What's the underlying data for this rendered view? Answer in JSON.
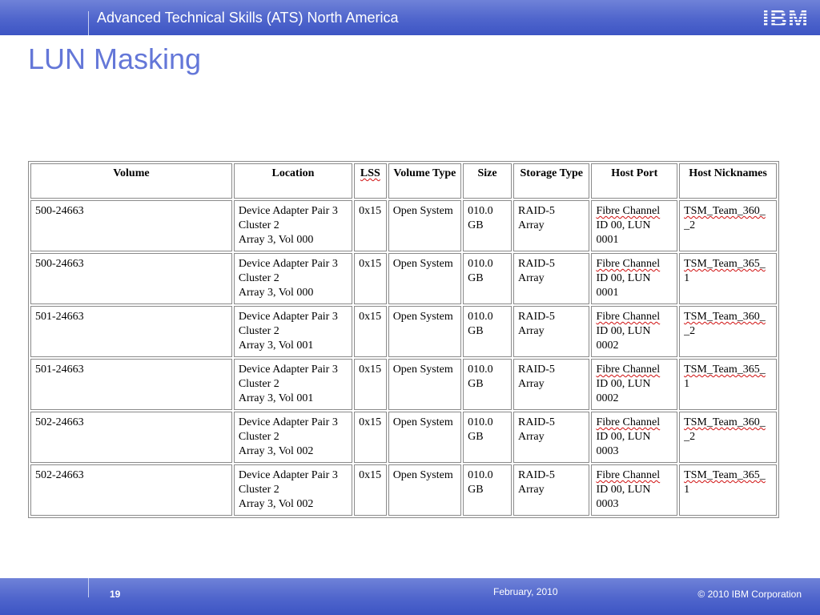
{
  "header": {
    "org_title": "Advanced Technical Skills (ATS) North America",
    "logo_text": "IBM",
    "accent_color": "#4f65cc"
  },
  "slide": {
    "title": "LUN Masking"
  },
  "table": {
    "columns": [
      "Volume",
      "Location",
      "LSS",
      "Volume Type",
      "Size",
      "Storage Type",
      "Host Port",
      "Host Nicknames"
    ],
    "rows": [
      {
        "volume": "500-24663",
        "location": [
          "Device Adapter Pair 3",
          "Cluster 2",
          "Array 3, Vol 000"
        ],
        "lss": "0x15",
        "volume_type": "Open System",
        "size": [
          "010.0",
          "GB"
        ],
        "storage_type": [
          "RAID-5",
          "Array"
        ],
        "host_port": [
          "Fibre Channel",
          "ID 00, LUN",
          "0001"
        ],
        "host_nickname": [
          "TSM_Team_360_",
          "_2"
        ]
      },
      {
        "volume": "500-24663",
        "location": [
          "Device Adapter Pair 3",
          "Cluster 2",
          "Array 3, Vol 000"
        ],
        "lss": "0x15",
        "volume_type": "Open System",
        "size": [
          "010.0",
          "GB"
        ],
        "storage_type": [
          "RAID-5",
          "Array"
        ],
        "host_port": [
          "Fibre Channel",
          "ID 00, LUN",
          "0001"
        ],
        "host_nickname": [
          "TSM_Team_365_",
          "1"
        ]
      },
      {
        "volume": "501-24663",
        "location": [
          "Device Adapter Pair 3",
          "Cluster 2",
          "Array 3, Vol 001"
        ],
        "lss": "0x15",
        "volume_type": "Open System",
        "size": [
          "010.0",
          "GB"
        ],
        "storage_type": [
          "RAID-5",
          "Array"
        ],
        "host_port": [
          "Fibre Channel",
          "ID 00, LUN",
          "0002"
        ],
        "host_nickname": [
          "TSM_Team_360_",
          "_2"
        ]
      },
      {
        "volume": "501-24663",
        "location": [
          "Device Adapter Pair 3",
          "Cluster 2",
          "Array 3, Vol 001"
        ],
        "lss": "0x15",
        "volume_type": "Open System",
        "size": [
          "010.0",
          "GB"
        ],
        "storage_type": [
          "RAID-5",
          "Array"
        ],
        "host_port": [
          "Fibre Channel",
          "ID 00, LUN",
          "0002"
        ],
        "host_nickname": [
          "TSM_Team_365_",
          "1"
        ]
      },
      {
        "volume": "502-24663",
        "location": [
          "Device Adapter Pair 3",
          "Cluster 2",
          "Array 3, Vol 002"
        ],
        "lss": "0x15",
        "volume_type": "Open System",
        "size": [
          "010.0",
          "GB"
        ],
        "storage_type": [
          "RAID-5",
          "Array"
        ],
        "host_port": [
          "Fibre Channel",
          "ID 00, LUN",
          "0003"
        ],
        "host_nickname": [
          "TSM_Team_360_",
          "_2"
        ]
      },
      {
        "volume": "502-24663",
        "location": [
          "Device Adapter Pair 3",
          "Cluster 2",
          "Array 3, Vol 002"
        ],
        "lss": "0x15",
        "volume_type": "Open System",
        "size": [
          "010.0",
          "GB"
        ],
        "storage_type": [
          "RAID-5",
          "Array"
        ],
        "host_port": [
          "Fibre Channel",
          "ID 00, LUN",
          "0003"
        ],
        "host_nickname": [
          "TSM_Team_365_",
          "1"
        ]
      }
    ]
  },
  "footer": {
    "page_number": "19",
    "date": "February, 2010",
    "copyright": "© 2010 IBM Corporation"
  }
}
